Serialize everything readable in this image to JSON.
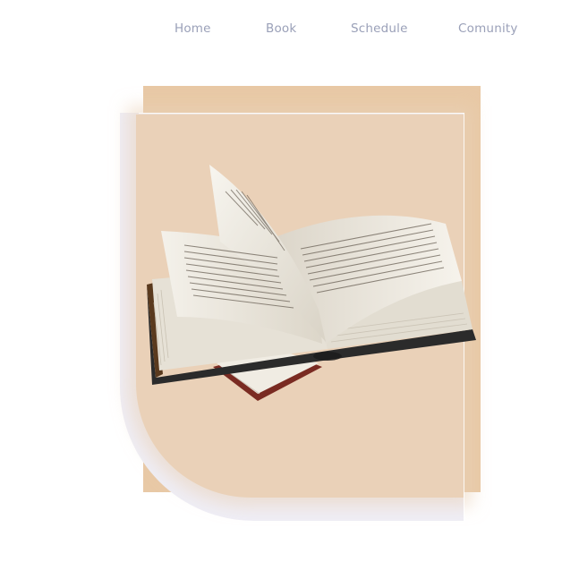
{
  "nav": {
    "items": [
      {
        "label": "Home"
      },
      {
        "label": "Book"
      },
      {
        "label": "Schedule"
      },
      {
        "label": "Comunity"
      }
    ]
  },
  "hero": {
    "image": "open-book-illustration"
  },
  "colors": {
    "nav_text": "#9aa0b8",
    "tan_back": "#e8c9a6",
    "peach_panel": "#ead1b8",
    "lavender": "#efeef6",
    "background": "#ffffff"
  }
}
